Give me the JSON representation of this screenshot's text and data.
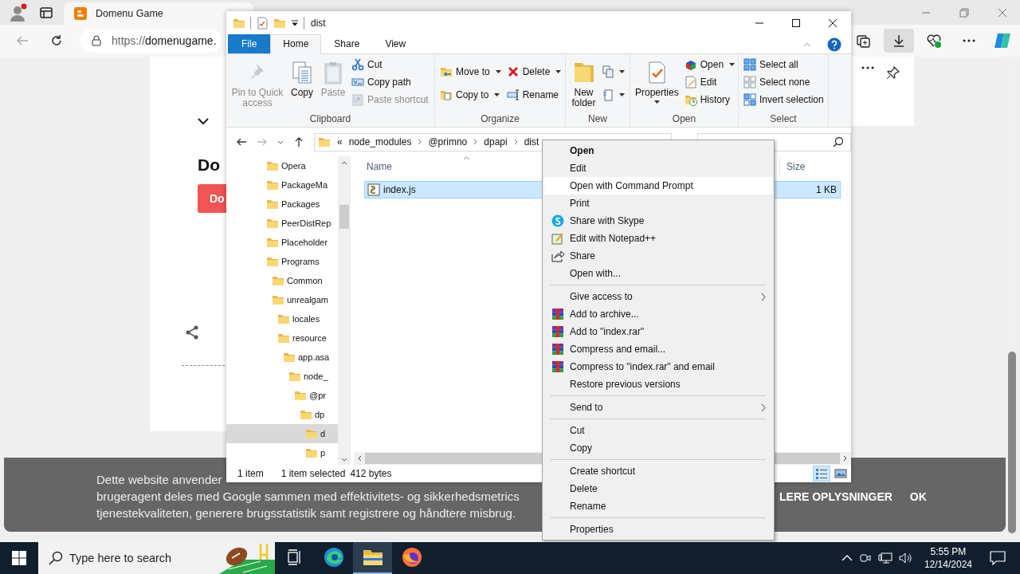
{
  "browser": {
    "tab": {
      "title": "Domenu Game"
    },
    "address": {
      "scheme": "https://",
      "host": "domenugame."
    },
    "page": {
      "heading": "Do",
      "button": "Do"
    },
    "cookie_banner": {
      "lines": [
        "Dette website anvender",
        "brugeragent deles med Google sammen med effektivitets- og sikkerhedsmetrics",
        "tjenestekvaliteten, generere brugsstatistik samt registrere og håndtere misbrug."
      ],
      "more_link": "LERE OPLYSNINGER",
      "ok_button": "OK"
    }
  },
  "explorer": {
    "title": "dist",
    "tabs": [
      {
        "label": "File",
        "kind": "file",
        "selected": false
      },
      {
        "label": "Home",
        "kind": "tab",
        "selected": true
      },
      {
        "label": "Share",
        "kind": "tab",
        "selected": false
      },
      {
        "label": "View",
        "kind": "tab",
        "selected": false
      }
    ],
    "ribbon": [
      {
        "label": "Clipboard",
        "columns": [
          [
            {
              "label": "Pin to Quick access",
              "kind": "large",
              "disabled": true
            }
          ],
          [
            {
              "label": "Copy",
              "kind": "large",
              "disabled": false
            }
          ],
          [
            {
              "label": "Paste",
              "kind": "large",
              "disabled": true
            }
          ],
          [
            {
              "label": "Cut",
              "kind": "small",
              "disabled": false
            },
            {
              "label": "Copy path",
              "kind": "small",
              "disabled": false
            },
            {
              "label": "Paste shortcut",
              "kind": "small",
              "disabled": true
            }
          ]
        ]
      },
      {
        "label": "Organize",
        "columns": [
          [
            {
              "label": "Move to",
              "kind": "small",
              "disabled": false,
              "dropdown": true
            },
            {
              "label": "Copy to",
              "kind": "small",
              "disabled": false,
              "dropdown": true
            }
          ],
          [
            {
              "label": "Delete",
              "kind": "small",
              "disabled": false,
              "dropdown": true
            },
            {
              "label": "Rename",
              "kind": "small",
              "disabled": false
            }
          ]
        ]
      },
      {
        "label": "New",
        "columns": [
          [
            {
              "label": "New folder",
              "kind": "large",
              "disabled": false
            }
          ],
          [
            {
              "kind": "small",
              "disabled": false,
              "dropdown": true
            },
            {
              "kind": "small",
              "disabled": false,
              "dropdown": true
            }
          ]
        ]
      },
      {
        "label": "Open",
        "columns": [
          [
            {
              "label": "Properties",
              "kind": "large",
              "disabled": false,
              "dropdown": true
            }
          ],
          [
            {
              "label": "Open",
              "kind": "small",
              "disabled": false,
              "dropdown": true
            },
            {
              "label": "Edit",
              "kind": "small",
              "disabled": false
            },
            {
              "label": "History",
              "kind": "small",
              "disabled": false
            }
          ]
        ]
      },
      {
        "label": "Select",
        "columns": [
          [
            {
              "label": "Select all",
              "kind": "small",
              "disabled": false
            },
            {
              "label": "Select none",
              "kind": "small",
              "disabled": false
            },
            {
              "label": "Invert selection",
              "kind": "small",
              "disabled": false
            }
          ]
        ]
      }
    ],
    "breadcrumb": {
      "overflow": "«",
      "parts": [
        "node_modules",
        "@primno",
        "dpapi",
        "dist"
      ]
    },
    "tree": [
      {
        "label": "Opera",
        "selected": false
      },
      {
        "label": "PackageMa",
        "selected": false
      },
      {
        "label": "Packages",
        "selected": false
      },
      {
        "label": "PeerDistRep",
        "selected": false
      },
      {
        "label": "Placeholder",
        "selected": false
      },
      {
        "label": "Programs",
        "selected": false,
        "children": [
          {
            "label": "Common",
            "selected": false
          },
          {
            "label": "unrealgam",
            "selected": false,
            "children": [
              {
                "label": "locales",
                "selected": false
              },
              {
                "label": "resource",
                "selected": false,
                "children": [
                  {
                    "label": "app.asa",
                    "selected": false,
                    "children": [
                      {
                        "label": "node_",
                        "selected": false,
                        "children": [
                          {
                            "label": "@pr",
                            "selected": false,
                            "children": [
                              {
                                "label": "dp",
                                "selected": false,
                                "children": [
                                  {
                                    "label": "d",
                                    "selected": true
                                  },
                                  {
                                    "label": "p",
                                    "selected": false
                                  }
                                ]
                              }
                            ]
                          }
                        ]
                      }
                    ]
                  }
                ]
              }
            ]
          }
        ]
      }
    ],
    "columns": [
      {
        "label": "Name",
        "sorted": true
      },
      {
        "label": "Size",
        "sorted": false
      }
    ],
    "files": [
      {
        "name": "index.js",
        "size": "1 KB",
        "selected": true
      }
    ],
    "status_bar": {
      "count": "1 item",
      "selection": "1 item selected",
      "size": "412 bytes"
    }
  },
  "context_menu": [
    {
      "kind": "item",
      "label": "Open",
      "bold": true,
      "highlighted": false
    },
    {
      "kind": "item",
      "label": "Edit",
      "bold": false,
      "highlighted": false
    },
    {
      "kind": "item",
      "label": "Open with Command Prompt",
      "bold": false,
      "highlighted": true
    },
    {
      "kind": "item",
      "label": "Print",
      "bold": false,
      "highlighted": false
    },
    {
      "kind": "item",
      "label": "Share with Skype",
      "bold": false,
      "highlighted": false
    },
    {
      "kind": "item",
      "label": "Edit with Notepad++",
      "bold": false,
      "highlighted": false
    },
    {
      "kind": "item",
      "label": "Share",
      "bold": false,
      "highlighted": false
    },
    {
      "kind": "item",
      "label": "Open with...",
      "bold": false,
      "highlighted": false
    },
    {
      "kind": "separator"
    },
    {
      "kind": "item",
      "label": "Give access to",
      "bold": false,
      "highlighted": false,
      "submenu": true
    },
    {
      "kind": "item",
      "label": "Add to archive...",
      "bold": false,
      "highlighted": false
    },
    {
      "kind": "item",
      "label": "Add to \"index.rar\"",
      "bold": false,
      "highlighted": false
    },
    {
      "kind": "item",
      "label": "Compress and email...",
      "bold": false,
      "highlighted": false
    },
    {
      "kind": "item",
      "label": "Compress to \"index.rar\" and email",
      "bold": false,
      "highlighted": false
    },
    {
      "kind": "item",
      "label": "Restore previous versions",
      "bold": false,
      "highlighted": false
    },
    {
      "kind": "separator"
    },
    {
      "kind": "item",
      "label": "Send to",
      "bold": false,
      "highlighted": false,
      "submenu": true
    },
    {
      "kind": "separator"
    },
    {
      "kind": "item",
      "label": "Cut",
      "bold": false,
      "highlighted": false
    },
    {
      "kind": "item",
      "label": "Copy",
      "bold": false,
      "highlighted": false
    },
    {
      "kind": "separator"
    },
    {
      "kind": "item",
      "label": "Create shortcut",
      "bold": false,
      "highlighted": false
    },
    {
      "kind": "item",
      "label": "Delete",
      "bold": false,
      "highlighted": false
    },
    {
      "kind": "item",
      "label": "Rename",
      "bold": false,
      "highlighted": false
    },
    {
      "kind": "separator"
    },
    {
      "kind": "item",
      "label": "Properties",
      "bold": false,
      "highlighted": false
    }
  ],
  "taskbar": {
    "search_placeholder": "Type here to search",
    "apps": [
      {
        "kind": "task-view",
        "selected": false
      },
      {
        "kind": "edge",
        "selected": false
      },
      {
        "kind": "files",
        "selected": true
      },
      {
        "kind": "firefox",
        "selected": false
      }
    ],
    "clock": {
      "time": "5:55 PM",
      "date": "12/14/2024"
    }
  }
}
